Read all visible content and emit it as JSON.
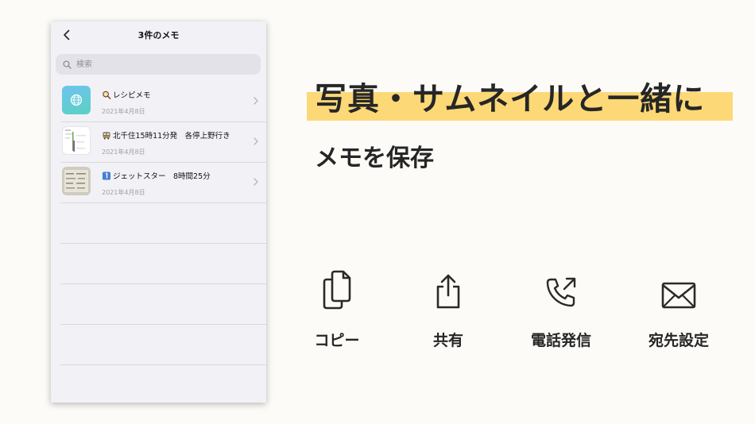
{
  "phone": {
    "nav_title": "3件のメモ",
    "search_placeholder": "検索",
    "memos": [
      {
        "title": "レシピメモ",
        "date": "2021年4月8日"
      },
      {
        "title": "北千住15時11分発　各停上野行き",
        "date": "2021年4月8日"
      },
      {
        "title": "ジェットスター　8時間25分",
        "date": "2021年4月8日"
      }
    ]
  },
  "headline": "写真・サムネイルと一緒に",
  "subheadline": "メモを保存",
  "features": [
    {
      "label": "コピー",
      "icon": "copy-icon"
    },
    {
      "label": "共有",
      "icon": "share-icon"
    },
    {
      "label": "電話発信",
      "icon": "phone-outgoing-icon"
    },
    {
      "label": "宛先設定",
      "icon": "envelope-icon"
    }
  ],
  "colors": {
    "background": "#fcfbf7",
    "highlight": "#fcd877",
    "phone_bg": "#f2f1f6",
    "text": "#262626"
  }
}
